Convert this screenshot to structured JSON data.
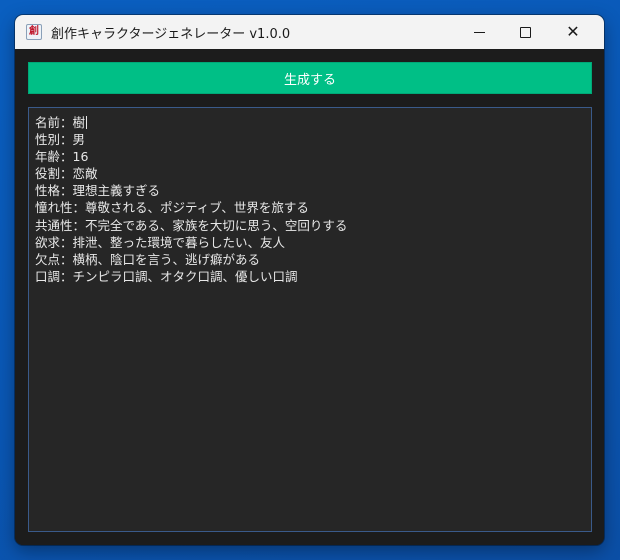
{
  "window": {
    "title": "創作キャラクタージェネレーター v1.0.0",
    "icon_glyph": "創",
    "icon_name": "app-icon",
    "controls": {
      "minimize_icon": "minimize-icon",
      "maximize_icon": "maximize-icon",
      "close_icon": "close-icon",
      "close_glyph": "✕"
    }
  },
  "toolbar": {
    "generate_label": "生成する",
    "accent_color": "#00bf86"
  },
  "output": {
    "lines": [
      {
        "label": "名前",
        "value": "樹"
      },
      {
        "label": "性別",
        "value": "男"
      },
      {
        "label": "年齢",
        "value": "16"
      },
      {
        "label": "役割",
        "value": "恋敵"
      },
      {
        "label": "性格",
        "value": "理想主義すぎる"
      },
      {
        "label": "憧れ性",
        "value": "尊敬される、ポジティブ、世界を旅する"
      },
      {
        "label": "共通性",
        "value": "不完全である、家族を大切に思う、空回りする"
      },
      {
        "label": "欲求",
        "value": "排泄、整った環境で暮らしたい、友人"
      },
      {
        "label": "欠点",
        "value": "横柄、陰口を言う、逃げ癖がある"
      },
      {
        "label": "口調",
        "value": "チンピラ口調、オタク口調、優しい口調"
      }
    ],
    "separator": "："
  }
}
